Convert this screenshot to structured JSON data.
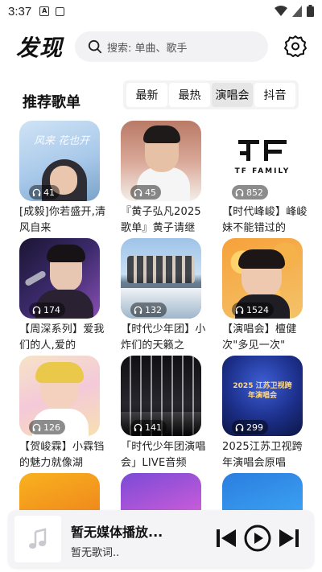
{
  "status_bar": {
    "time": "3:37"
  },
  "header": {
    "logo": "发现",
    "search_placeholder": "搜索: 单曲、歌手"
  },
  "section": {
    "title": "推荐歌单",
    "tabs": [
      {
        "label": "最新",
        "active": false
      },
      {
        "label": "最热",
        "active": false
      },
      {
        "label": "演唱会",
        "active": true
      },
      {
        "label": "抖音",
        "active": false
      }
    ]
  },
  "playlists": [
    {
      "plays": "41",
      "title": "[成毅]你若盛开,清风自来",
      "cover_text": "风来 花也开"
    },
    {
      "plays": "45",
      "title": "『黄子弘凡2025歌单』黄子请继",
      "cover_text": ""
    },
    {
      "plays": "852",
      "title": "【时代峰峻】峰峻妹不能错过的",
      "cover_text": "TF FAMILY"
    },
    {
      "plays": "174",
      "title": "【周深系列】爱我们的人,爱的",
      "cover_text": ""
    },
    {
      "plays": "132",
      "title": "【时代少年团】小炸们的天籁之",
      "cover_text": ""
    },
    {
      "plays": "1524",
      "title": "【演唱会】檀健次\"多见一次\"",
      "cover_text": ""
    },
    {
      "plays": "126",
      "title": "【贺峻霖】小霖铛的魅力就像湖",
      "cover_text": ""
    },
    {
      "plays": "141",
      "title": "「时代少年团演唱会」LIVE音频",
      "cover_text": ""
    },
    {
      "plays": "299",
      "title": "2025江苏卫视跨年演唱会原唱",
      "cover_text": "2025 江苏卫视跨年演唱会"
    },
    {
      "plays": "",
      "title": "",
      "cover_text": ""
    },
    {
      "plays": "",
      "title": "",
      "cover_text": ""
    },
    {
      "plays": "",
      "title": "",
      "cover_text": ""
    }
  ],
  "player": {
    "title": "暂无媒体播放...",
    "lyric": "暂无歌词.."
  },
  "colors": {
    "accent": "#111111",
    "tab_bg": "#f3f3f3",
    "tab_active": "#e6e6e6",
    "search_bg": "#f2f2f4"
  }
}
